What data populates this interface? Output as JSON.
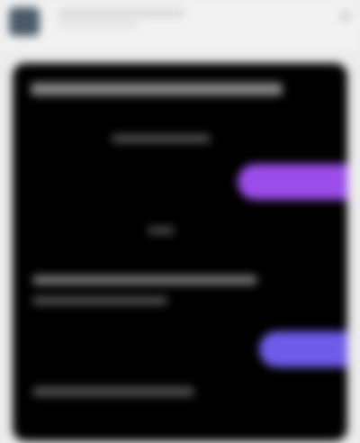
{
  "post": {
    "author": "",
    "meta": ""
  },
  "media": {
    "lines": [
      "",
      "",
      "",
      "",
      "",
      ""
    ],
    "bubbles": [
      "",
      ""
    ]
  },
  "colors": {
    "header_bg": "#f2f2f2",
    "media_bg": "#000000",
    "bubble_purple": "#9a4de8",
    "bubble_indigo": "#6f5bea"
  }
}
